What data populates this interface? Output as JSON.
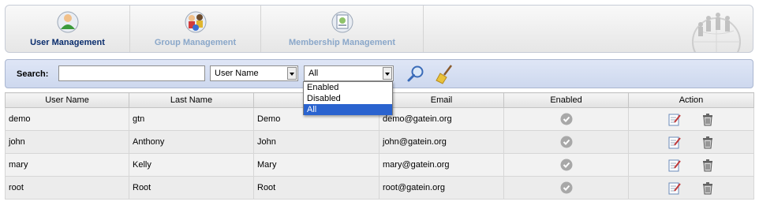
{
  "tabs": [
    {
      "label": "User Management",
      "icon": "user-icon",
      "active": true
    },
    {
      "label": "Group Management",
      "icon": "group-icon",
      "active": false
    },
    {
      "label": "Membership Management",
      "icon": "membership-icon",
      "active": false
    }
  ],
  "search": {
    "label": "Search:",
    "value": "",
    "placeholder": "",
    "field_select": "User Name",
    "enabled_select": "All",
    "enabled_options": [
      "Enabled",
      "Disabled",
      "All"
    ],
    "selected_option": "All"
  },
  "table": {
    "headers": [
      "User Name",
      "Last Name",
      "Fi",
      "Email",
      "Enabled",
      "Action"
    ],
    "rows": [
      {
        "user": "demo",
        "last": "gtn",
        "first": "Demo",
        "email": "demo@gatein.org"
      },
      {
        "user": "john",
        "last": "Anthony",
        "first": "John",
        "email": "john@gatein.org"
      },
      {
        "user": "mary",
        "last": "Kelly",
        "first": "Mary",
        "email": "mary@gatein.org"
      },
      {
        "user": "root",
        "last": "Root",
        "first": "Root",
        "email": "root@gatein.org"
      }
    ]
  },
  "colors": {
    "active_tab": "#0a2d6d",
    "inactive_tab": "#8aa7c9",
    "search_bar": "#d5def2",
    "selected_option": "#2a63cf"
  }
}
